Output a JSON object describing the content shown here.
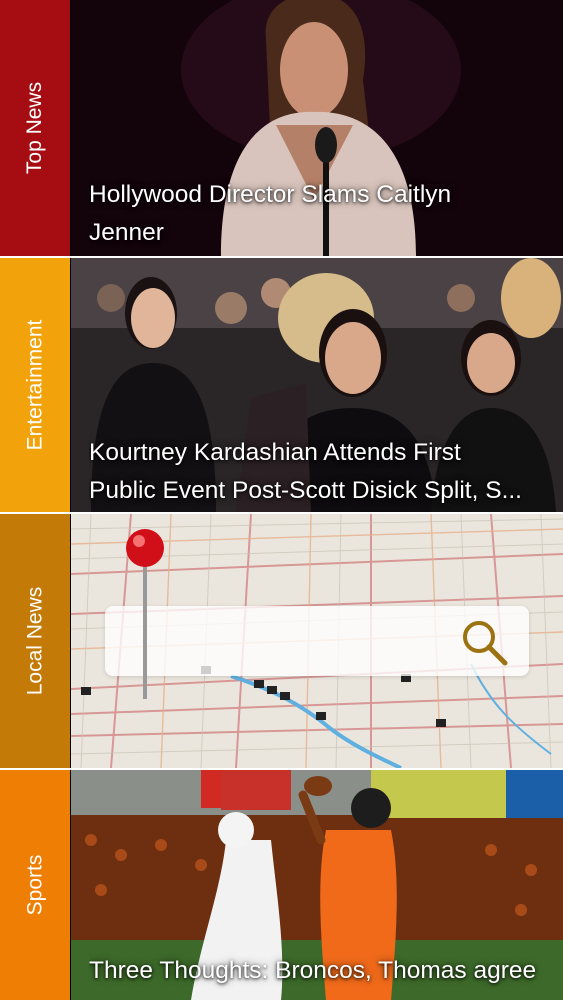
{
  "sections": [
    {
      "id": "top-news",
      "label": "Top News",
      "headline_lines": [
        "Hollywood Director Slams Caitlyn",
        "Jenner"
      ],
      "color": "#a50d12"
    },
    {
      "id": "entertainment",
      "label": "Entertainment",
      "headline_lines": [
        "Kourtney Kardashian Attends First",
        "Public Event Post-Scott Disick Split, S..."
      ],
      "color": "#f2a30c"
    },
    {
      "id": "local-news",
      "label": "Local News",
      "search": {
        "placeholder": ""
      },
      "color": "#c47a06"
    },
    {
      "id": "sports",
      "label": "Sports",
      "headline_lines": [
        "Three Thoughts: Broncos, Thomas agree"
      ],
      "color": "#ef7e05"
    }
  ],
  "icons": {
    "search": "magnifier-icon",
    "pin": "map-pin-icon"
  }
}
